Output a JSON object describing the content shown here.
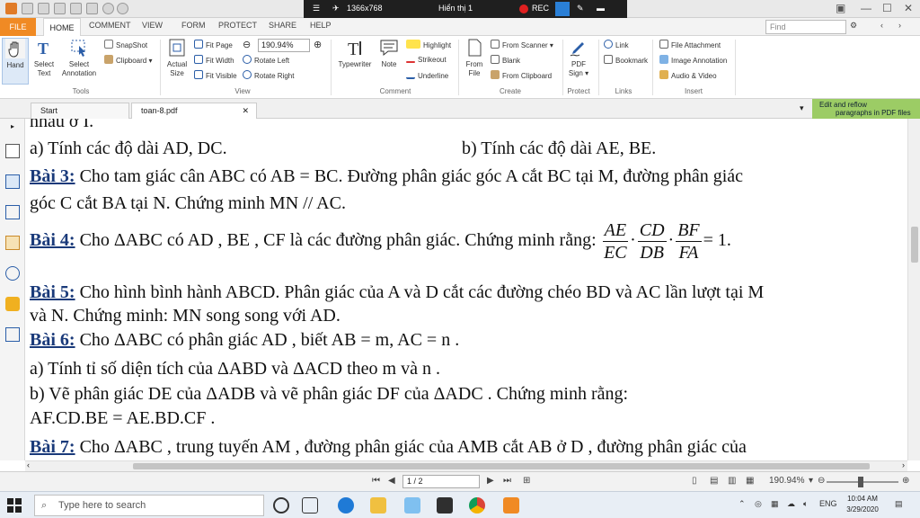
{
  "titlebar": {
    "resolution": "1366x768",
    "display": "Hiển thị 1",
    "rec": "REC"
  },
  "ribbon_tabs": [
    "FILE",
    "HOME",
    "COMMENT",
    "VIEW",
    "FORM",
    "PROTECT",
    "SHARE",
    "HELP"
  ],
  "find_placeholder": "Find",
  "ribbon": {
    "hand": "Hand",
    "select_text_1": "Select",
    "select_text_2": "Text",
    "select_annot_1": "Select",
    "select_annot_2": "Annotation",
    "snapshot": "SnapShot",
    "clipboard": "Clipboard",
    "group_tools": "Tools",
    "actual_size_1": "Actual",
    "actual_size_2": "Size",
    "fit_page": "Fit Page",
    "fit_width": "Fit Width",
    "fit_visible": "Fit Visible",
    "zoom_value": "190.94%",
    "rotate_left": "Rotate Left",
    "rotate_right": "Rotate Right",
    "group_view": "View",
    "typewriter": "Typewriter",
    "note": "Note",
    "highlight": "Highlight",
    "strikeout": "Strikeout",
    "underline": "Underline",
    "group_comment": "Comment",
    "from_file_1": "From",
    "from_file_2": "File",
    "from_scanner": "From Scanner",
    "blank": "Blank",
    "from_clipboard": "From Clipboard",
    "group_create": "Create",
    "pdf_sign_1": "PDF",
    "pdf_sign_2": "Sign",
    "group_protect": "Protect",
    "link": "Link",
    "bookmark": "Bookmark",
    "group_links": "Links",
    "file_attachment": "File Attachment",
    "image_annotation": "Image Annotation",
    "audio_video": "Audio & Video",
    "group_insert": "Insert"
  },
  "doc_tabs": [
    "Start",
    "toan-8.pdf"
  ],
  "tip_line1": "Edit and reflow",
  "tip_line2": "paragraphs in PDF files",
  "doc": {
    "l0": "nhau ở I.",
    "l1a": "a) Tính các độ dài  AD, DC.",
    "l1b": "b) Tính các độ dài  AE, BE.",
    "b3_label": "Bài 3:",
    "b3_text": "  Cho tam giác cân  ABC  có  AB = BC. Đường phân giác góc  A  cắt  BC  tại  M, đường phân giác",
    "b3_text2": "góc  C  cắt  BA  tại  N. Chứng minh  MN // AC.",
    "b4_label": "Bài 4:",
    "b4_text": " Cho  ΔABC  có  AD ,  BE ,  CF  là các đường phân giác.  Chứng minh rằng: ",
    "b4_f1n": "AE",
    "b4_f1d": "EC",
    "b4_f2n": "CD",
    "b4_f2d": "DB",
    "b4_f3n": "BF",
    "b4_f3d": "FA",
    "b4_end": "= 1.",
    "b5_label": "Bài 5:",
    "b5_text": "  Cho hình bình hành ABCD. Phân giác của  A  và  D  cắt các đường chéo BD và AC lần lượt tại M",
    "b5_text2": "và N. Chứng minh: MN song song với AD.",
    "b6_label": "Bài 6:",
    "b6_text": "  Cho  ΔABC có phân giác AD , biết AB = m, AC = n .",
    "b6_a": "a) Tính tỉ số diện tích của  ΔABD và  ΔACD theo  m và  n .",
    "b6_b": "b) Vẽ phân giác  DE của  ΔADB và vẽ phân giác  DF của  ΔADC . Chứng minh rằng:",
    "b6_c": " AF.CD.BE = AE.BD.CF .",
    "b7_label": "Bài 7:",
    "b7_text": "  Cho  ΔABC , trung tuyến  AM , đường phân giác của  AMB cắt  AB ở  D , đường phân giác của"
  },
  "status": {
    "page": "1 / 2",
    "zoom": "190.94%"
  },
  "taskbar": {
    "search_placeholder": "Type here to search",
    "lang": "ENG",
    "time": "10:04 AM",
    "date": "3/29/2020"
  },
  "colors": {
    "file_tab": "#f08a24",
    "lesson_label": "#1a3a7a",
    "tip_bg": "#9ccc65"
  }
}
